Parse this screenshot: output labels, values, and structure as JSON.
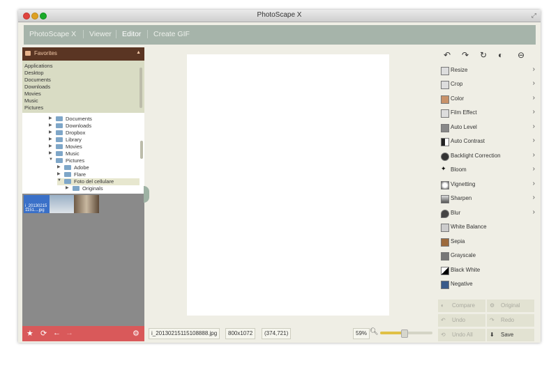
{
  "window": {
    "title": "PhotoScape X"
  },
  "nav": {
    "items": [
      "PhotoScape X",
      "Viewer",
      "Editor",
      "Create GIF"
    ],
    "active": "Editor"
  },
  "favorites": {
    "header": "Favorites",
    "items": [
      "Applications",
      "Desktop",
      "Documents",
      "Downloads",
      "Movies",
      "Music",
      "Pictures"
    ]
  },
  "tree": {
    "items": [
      {
        "label": "Documents",
        "expanded": false
      },
      {
        "label": "Downloads",
        "expanded": false
      },
      {
        "label": "Dropbox",
        "expanded": false
      },
      {
        "label": "Library",
        "expanded": false
      },
      {
        "label": "Movies",
        "expanded": false
      },
      {
        "label": "Music",
        "expanded": false
      },
      {
        "label": "Pictures",
        "expanded": true
      },
      {
        "label": "Adobe",
        "expanded": false
      },
      {
        "label": "Flare",
        "expanded": false
      },
      {
        "label": "Foto del cellulare",
        "expanded": true,
        "selected": true
      },
      {
        "label": "Originals",
        "expanded": false
      }
    ]
  },
  "thumbnails": {
    "first_caption": "i_20130215 1151....jpg"
  },
  "status": {
    "filename": "i_20130215115108888.jpg",
    "dimensions": "800x1072",
    "coords": "(374,721)",
    "zoom": "59%",
    "zoom_fraction": 0.45
  },
  "tools": {
    "items": [
      {
        "label": "Resize",
        "icon": "resize-icon",
        "chevron": true
      },
      {
        "label": "Crop",
        "icon": "crop-icon",
        "chevron": true
      },
      {
        "label": "Color",
        "icon": "color-icon",
        "chevron": true
      },
      {
        "label": "Film Effect",
        "icon": "film-icon",
        "chevron": true
      },
      {
        "label": "Auto Level",
        "icon": "auto-level-icon",
        "chevron": true
      },
      {
        "label": "Auto Contrast",
        "icon": "contrast-icon",
        "chevron": true
      },
      {
        "label": "Backlight Correction",
        "icon": "backlight-icon",
        "chevron": true
      },
      {
        "label": "Bloom",
        "icon": "bloom-icon",
        "chevron": true
      },
      {
        "label": "Vignetting",
        "icon": "vignette-icon",
        "chevron": true
      },
      {
        "label": "Sharpen",
        "icon": "sharpen-icon",
        "chevron": true
      },
      {
        "label": "Blur",
        "icon": "blur-icon",
        "chevron": true
      },
      {
        "label": "White Balance",
        "icon": "white-balance-icon",
        "chevron": false
      },
      {
        "label": "Sepia",
        "icon": "sepia-icon",
        "chevron": false
      },
      {
        "label": "Grayscale",
        "icon": "grayscale-icon",
        "chevron": false
      },
      {
        "label": "Black  White",
        "icon": "black-white-icon",
        "chevron": false
      },
      {
        "label": "Negative",
        "icon": "negative-icon",
        "chevron": false
      }
    ]
  },
  "actions": {
    "compare": "Compare",
    "original": "Original",
    "undo": "Undo",
    "redo": "Redo",
    "undo_all": "Undo All",
    "save": "Save"
  },
  "colors": {
    "nav": "#a6b4aa",
    "favorites_header": "#5a3523",
    "left_footer": "#d9595a",
    "accent": "#e0c046"
  }
}
